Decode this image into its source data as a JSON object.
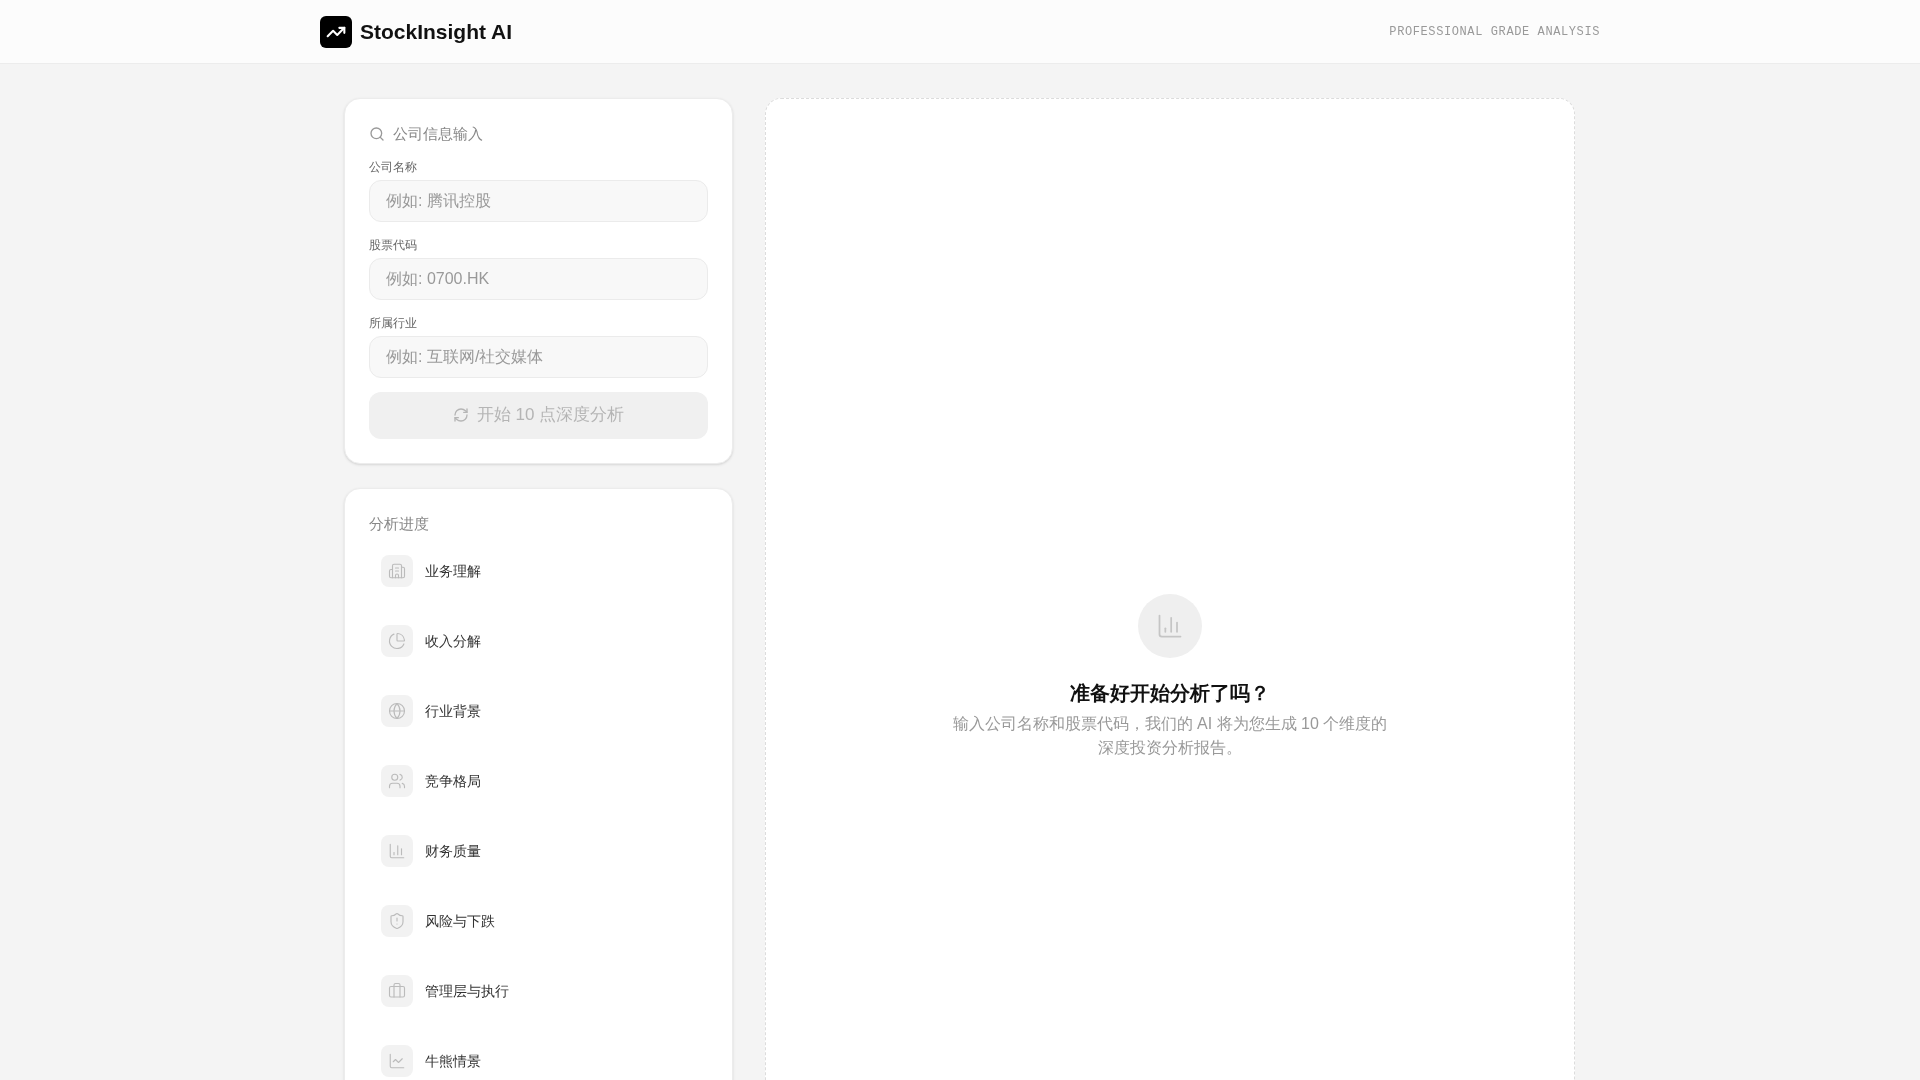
{
  "header": {
    "brand": "StockInsight AI",
    "tagline": "PROFESSIONAL GRADE ANALYSIS"
  },
  "input_card": {
    "title": "公司信息输入",
    "fields": [
      {
        "label": "公司名称",
        "placeholder": "例如: 腾讯控股"
      },
      {
        "label": "股票代码",
        "placeholder": "例如: 0700.HK"
      },
      {
        "label": "所属行业",
        "placeholder": "例如: 互联网/社交媒体"
      }
    ],
    "submit": {
      "label": "开始 10 点深度分析",
      "disabled": true
    }
  },
  "progress_card": {
    "title": "分析进度",
    "steps": [
      {
        "label": "业务理解"
      },
      {
        "label": "收入分解"
      },
      {
        "label": "行业背景"
      },
      {
        "label": "竞争格局"
      },
      {
        "label": "财务质量"
      },
      {
        "label": "风险与下跌"
      },
      {
        "label": "管理层与执行"
      },
      {
        "label": "牛熊情景"
      }
    ]
  },
  "empty_state": {
    "title": "准备好开始分析了吗？",
    "description": "输入公司名称和股票代码，我们的 AI 将为您生成 10 个维度的深度投资分析报告。"
  }
}
